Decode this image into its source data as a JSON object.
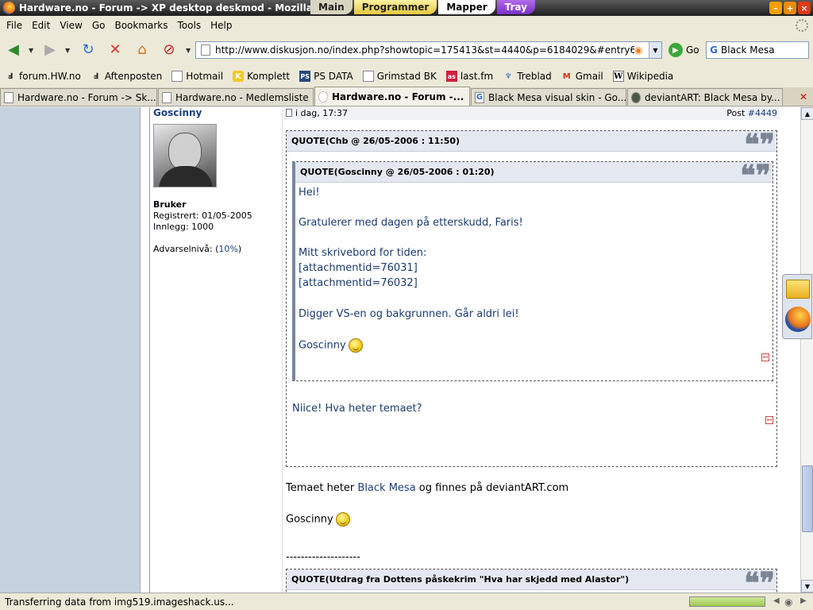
{
  "window": {
    "title": "Hardware.no - Forum -> XP desktop deskmod - Mozilla F",
    "desktop_tabs": [
      "Main",
      "Programmer",
      "Mapper",
      "Tray"
    ]
  },
  "menu": [
    "File",
    "Edit",
    "View",
    "Go",
    "Bookmarks",
    "Tools",
    "Help"
  ],
  "nav": {
    "url": "http://www.diskusjon.no/index.php?showtopic=175413&st=4440&p=6184029&#entry61840:",
    "go_label": "Go",
    "search_value": "Black Mesa"
  },
  "bookmarks": [
    {
      "label": "forum.HW.no",
      "icon": "hw-icon"
    },
    {
      "label": "Aftenposten",
      "icon": "aftenposten-icon"
    },
    {
      "label": "Hotmail",
      "icon": "page-icon"
    },
    {
      "label": "Komplett",
      "icon": "komplett-icon"
    },
    {
      "label": "PS DATA",
      "icon": "psdata-icon"
    },
    {
      "label": "Grimstad BK",
      "icon": "page-icon"
    },
    {
      "label": "last.fm",
      "icon": "lastfm-icon"
    },
    {
      "label": "Treblad",
      "icon": "treblad-icon"
    },
    {
      "label": "Gmail",
      "icon": "gmail-icon"
    },
    {
      "label": "Wikipedia",
      "icon": "wikipedia-icon"
    }
  ],
  "tabs": [
    {
      "label": "Hardware.no - Forum -> Sk...",
      "active": false
    },
    {
      "label": "Hardware.no - Medlemsliste",
      "active": false
    },
    {
      "label": "Hardware.no - Forum -...",
      "active": true
    },
    {
      "label": "Black Mesa visual skin - Go...",
      "active": false
    },
    {
      "label": "deviantART: Black Mesa by...",
      "active": false
    }
  ],
  "post": {
    "author": "Goscinny",
    "role": "Bruker",
    "registered": "Registrert: 01/05-2005",
    "posts": "Innlegg: 1000",
    "warn_prefix": "Advarselnivå: (",
    "warn_value": "10%",
    "warn_suffix": ")",
    "date": "i dag, 17:37",
    "post_prefix": "Post ",
    "post_number": "#4449",
    "quote_outer_header": "QUOTE(Chb @ 26/05-2006 : 11:50)",
    "quote_inner_header": "QUOTE(Goscinny @ 26/05-2006 : 01:20)",
    "inner_lines": [
      "Hei!",
      "Gratulerer med dagen på etterskudd, Faris!",
      "Mitt skrivebord for tiden:",
      "[attachmentid=76031]",
      "[attachmentid=76032]",
      "Digger VS-en og bakgrunnen. Går aldri lei!",
      "Goscinny"
    ],
    "outer_reply": "Niice! Hva heter temaet?",
    "main_prefix": "Temaet heter ",
    "main_link": "Black Mesa",
    "main_suffix": " og finnes på deviantART.com",
    "signature": "Goscinny",
    "separator": "--------------------",
    "quote3_header": "QUOTE(Utdrag fra Dottens påskekrim \"Hva har skjedd med Alastor\")"
  },
  "status": {
    "text": "Transferring data from img519.imageshack.us...",
    "progress": 1.0
  }
}
